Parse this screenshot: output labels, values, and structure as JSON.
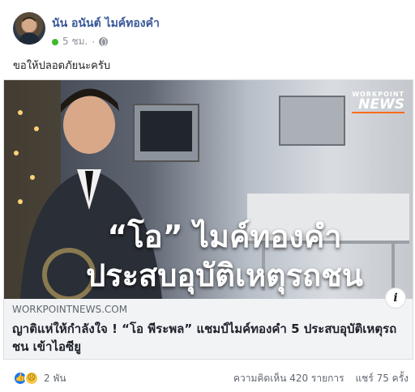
{
  "post": {
    "author": "นัน อนันต์ ไมค์ทองคำ",
    "time": "5 ชม.",
    "privacy_icon": "globe-icon",
    "caption": "ขอให้ปลอดภัยนะครับ"
  },
  "link_card": {
    "image_headline_line1": "“โอ” ไมค์ทองคำ",
    "image_headline_line2": "ประสบอุบัติเหตุรถชน",
    "brand_top": "WORKPOINT",
    "brand_bottom": "NEWS",
    "info_label": "i",
    "domain": "WORKPOINTNEWS.COM",
    "title": "ญาติแห่ให้กำลังใจ ! “โอ พีระพล” แชมป์ไมค์ทองคำ 5 ประสบอุบัติเหตุรถชน เข้าไอซียู"
  },
  "footer": {
    "reactions": [
      "like-icon",
      "sad-icon"
    ],
    "reaction_count": "2 พัน",
    "comments": "ความคิดเห็น 420 รายการ",
    "shares": "แชร์ 75 ครั้ง"
  },
  "colors": {
    "author_link": "#385898",
    "online": "#42b72a",
    "like": "#1877f2"
  }
}
